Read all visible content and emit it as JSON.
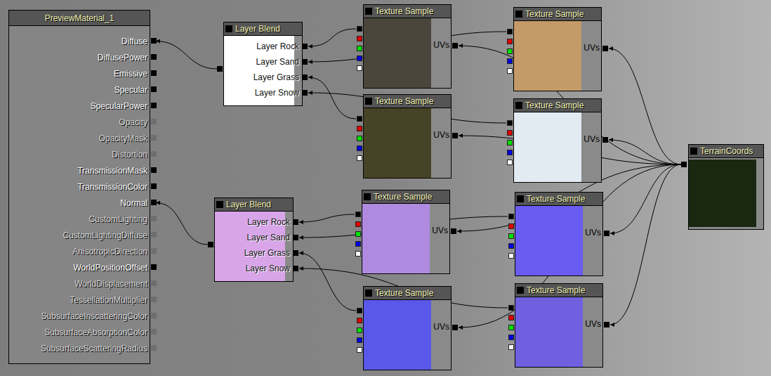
{
  "material": {
    "title": "PreviewMaterial_1",
    "inputs": [
      {
        "label": "Diffuse",
        "enabled": true,
        "connected": true
      },
      {
        "label": "DiffusePower",
        "enabled": true,
        "connected": false
      },
      {
        "label": "Emissive",
        "enabled": true,
        "connected": false
      },
      {
        "label": "Specular",
        "enabled": true,
        "connected": false
      },
      {
        "label": "SpecularPower",
        "enabled": true,
        "connected": false
      },
      {
        "label": "Opacity",
        "enabled": false,
        "connected": false
      },
      {
        "label": "OpacityMask",
        "enabled": false,
        "connected": false
      },
      {
        "label": "Distortion",
        "enabled": false,
        "connected": false
      },
      {
        "label": "TransmissionMask",
        "enabled": true,
        "connected": false
      },
      {
        "label": "TransmissionColor",
        "enabled": true,
        "connected": false
      },
      {
        "label": "Normal",
        "enabled": true,
        "connected": true
      },
      {
        "label": "CustomLighting",
        "enabled": false,
        "connected": false
      },
      {
        "label": "CustomLightingDiffuse",
        "enabled": false,
        "connected": false
      },
      {
        "label": "AnisotropicDirection",
        "enabled": false,
        "connected": false
      },
      {
        "label": "WorldPositionOffset",
        "enabled": true,
        "connected": false
      },
      {
        "label": "WorldDisplacement",
        "enabled": false,
        "connected": false
      },
      {
        "label": "TessellationMultiplier",
        "enabled": false,
        "connected": false
      },
      {
        "label": "SubsurfaceInscatteringColor",
        "enabled": false,
        "connected": false
      },
      {
        "label": "SubsurfaceAbsorptionColor",
        "enabled": false,
        "connected": false
      },
      {
        "label": "SubsurfaceScatteringRadius",
        "enabled": false,
        "connected": false
      }
    ]
  },
  "texture_outputs": [
    {
      "color": "#000000"
    },
    {
      "color": "#e00000"
    },
    {
      "color": "#00e000"
    },
    {
      "color": "#0000e0"
    },
    {
      "color": "#ffffff"
    }
  ],
  "layer_blends": [
    {
      "title": "Layer Blend",
      "preview_color": "#ffffff",
      "layers": [
        {
          "label": "Layer Rock",
          "texture": {
            "title": "Texture Sample",
            "uvs_label": "UVs",
            "preview_color": "#4a463c"
          }
        },
        {
          "label": "Layer Sand",
          "texture": {
            "title": "Texture Sample",
            "uvs_label": "UVs",
            "preview_color": "#c49a68"
          }
        },
        {
          "label": "Layer Grass",
          "texture": {
            "title": "Texture Sample",
            "uvs_label": "UVs",
            "preview_color": "#464326"
          }
        },
        {
          "label": "Layer Snow",
          "texture": {
            "title": "Texture Sample",
            "uvs_label": "UVs",
            "preview_color": "#e2eaf2"
          }
        }
      ]
    },
    {
      "title": "Layer Blend",
      "preview_color": "#d8a6e8",
      "layers": [
        {
          "label": "Layer Rock",
          "texture": {
            "title": "Texture Sample",
            "uvs_label": "UVs",
            "preview_color": "#b08ae0"
          }
        },
        {
          "label": "Layer Sand",
          "texture": {
            "title": "Texture Sample",
            "uvs_label": "UVs",
            "preview_color": "#6a5cf0"
          }
        },
        {
          "label": "Layer Grass",
          "texture": {
            "title": "Texture Sample",
            "uvs_label": "UVs",
            "preview_color": "#5a58e8"
          }
        },
        {
          "label": "Layer Snow",
          "texture": {
            "title": "Texture Sample",
            "uvs_label": "UVs",
            "preview_color": "#7060e0"
          }
        }
      ]
    }
  ],
  "terrain_coords": {
    "title": "TerrainCoords",
    "preview_color": "#1a2812"
  }
}
